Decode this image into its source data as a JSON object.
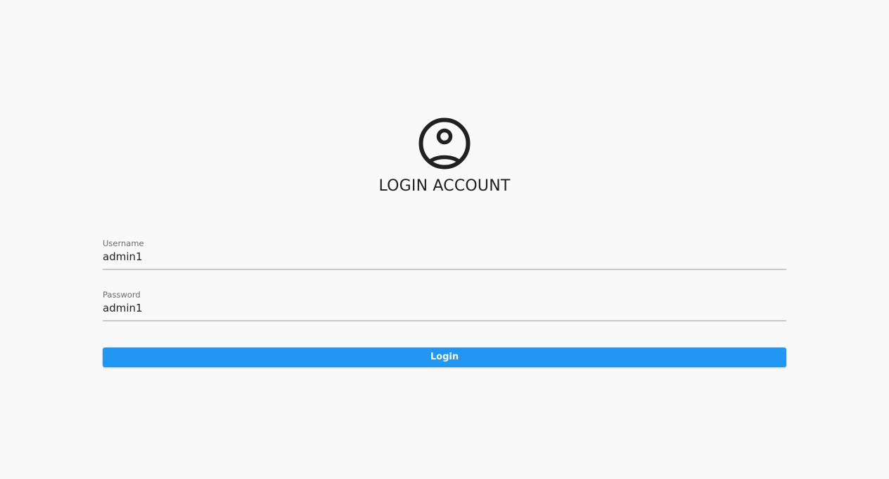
{
  "header": {
    "icon": "account-circle-icon",
    "title": "LOGIN ACCOUNT"
  },
  "form": {
    "username": {
      "label": "Username",
      "value": "admin1"
    },
    "password": {
      "label": "Password",
      "value": "admin1"
    },
    "login_label": "Login"
  },
  "colors": {
    "background": "#f9f9f9",
    "accent": "#2196f3",
    "underline": "#c8c8c8",
    "text": "#212121"
  }
}
